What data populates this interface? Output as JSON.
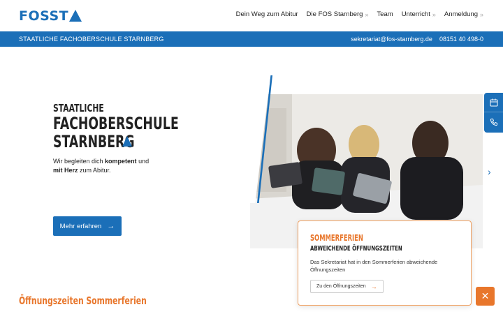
{
  "header": {
    "logo_text": "FOSST",
    "nav": [
      {
        "label": "Dein Weg zum Abitur",
        "has_chevron": false
      },
      {
        "label": "Die FOS Starnberg",
        "has_chevron": true
      },
      {
        "label": "Team",
        "has_chevron": false
      },
      {
        "label": "Unterricht",
        "has_chevron": true
      },
      {
        "label": "Anmeldung",
        "has_chevron": true
      }
    ],
    "chevron": "»"
  },
  "topbar": {
    "school_name": "STAATLICHE FACHOBERSCHULE STARNBERG",
    "email": "sekretariat@fos-starnberg.de",
    "phone": "08151 40 498-0"
  },
  "hero": {
    "title_line1": "STAATLICHE",
    "title_line2": "FACHOBERSCHULE",
    "title_line3": "STARNBERG",
    "subtitle_part1": "Wir begleiten dich ",
    "subtitle_bold1": "kompetent",
    "subtitle_part2": " und",
    "subtitle_bold2": "mit Herz",
    "subtitle_part3": " zum Abitur."
  },
  "cta": {
    "label": "Mehr erfahren",
    "arrow": "→"
  },
  "side_tabs": {
    "calendar_icon": "calendar-icon",
    "phone_icon": "phone-icon"
  },
  "carousel": {
    "next_glyph": "›"
  },
  "notice": {
    "title": "SOMMERFERIEN",
    "subtitle": "ABWEICHENDE ÖFFNUNGSZEITEN",
    "text": "Das Sekretariat hat in den Sommerferien abweichende Öffnungszeiten",
    "button_label": "Zu den Öffnungszeiten",
    "button_arrow": "→"
  },
  "close": {
    "glyph": "✕"
  },
  "section": {
    "title": "Öffnungszeiten Sommerferien"
  },
  "colors": {
    "brand_blue": "#1b6fb8",
    "accent_orange": "#e8762b"
  }
}
